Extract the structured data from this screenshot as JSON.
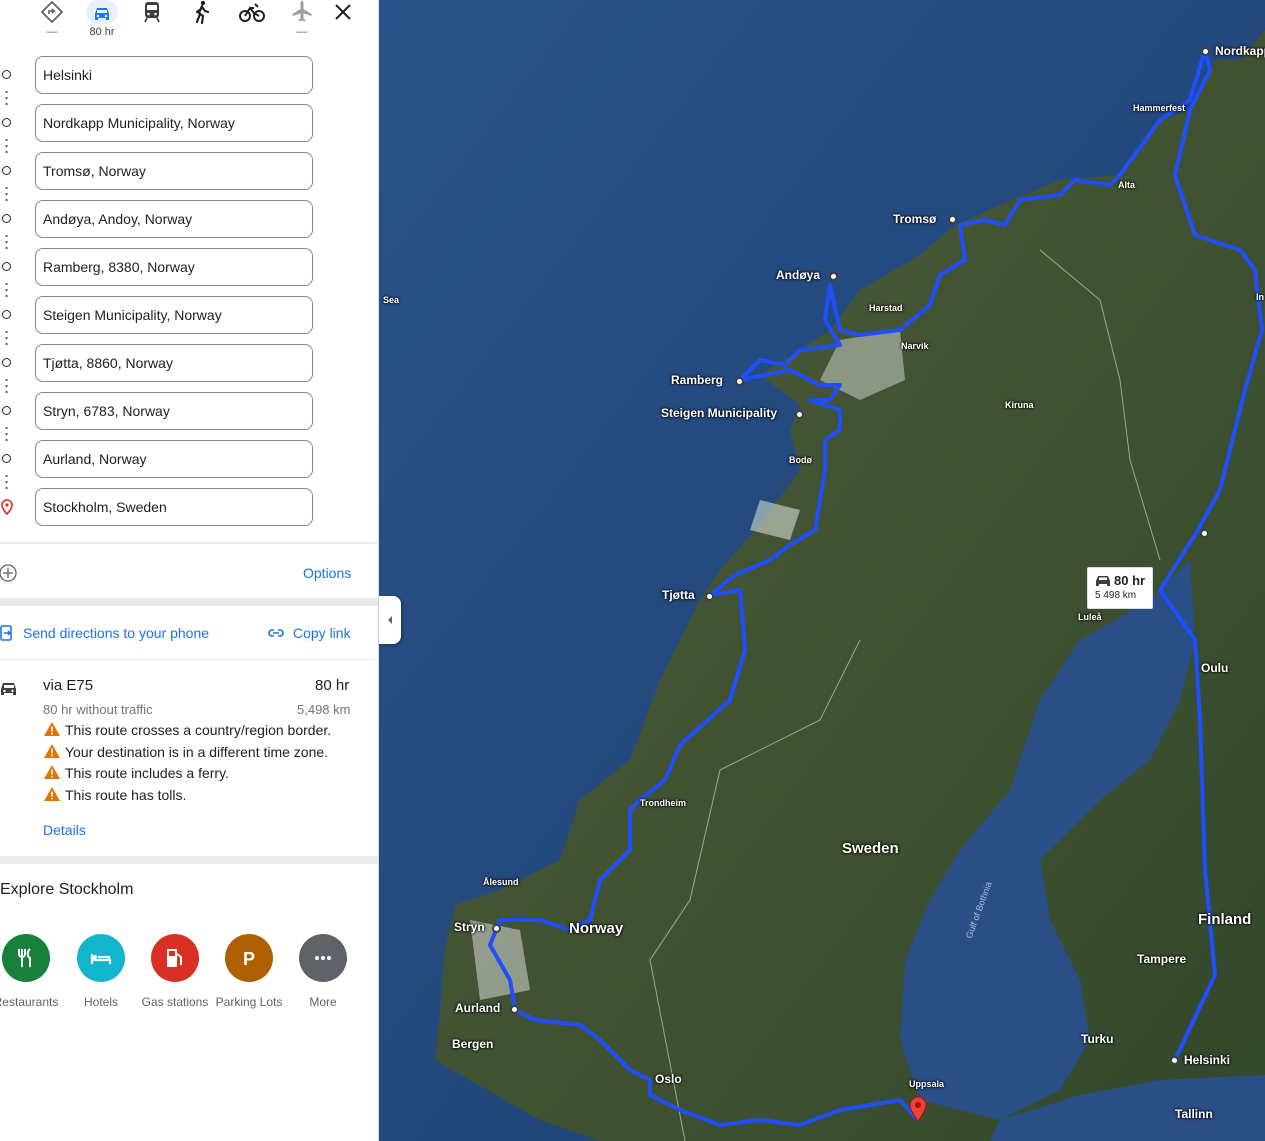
{
  "travel_modes": [
    {
      "name": "best",
      "label": "—"
    },
    {
      "name": "driving",
      "label": "80 hr"
    },
    {
      "name": "transit",
      "label": ""
    },
    {
      "name": "walking",
      "label": ""
    },
    {
      "name": "cycling",
      "label": ""
    },
    {
      "name": "flights",
      "label": "—"
    }
  ],
  "stops": [
    "Helsinki",
    "Nordkapp Municipality, Norway",
    "Tromsø, Norway",
    "Andøya, Andoy, Norway",
    "Ramberg, 8380, Norway",
    "Steigen Municipality, Norway",
    "Tjøtta, 8860, Norway",
    "Stryn, 6783, Norway",
    "Aurland, Norway",
    "Stockholm, Sweden"
  ],
  "options_label": "Options",
  "share": {
    "send": "Send directions to your phone",
    "copy": "Copy link"
  },
  "route": {
    "via": "via E75",
    "duration": "80 hr",
    "traffic": "80 hr without traffic",
    "distance": "5,498 km",
    "warnings": [
      "This route crosses a country/region border.",
      "Your destination is in a different time zone.",
      "This route includes a ferry.",
      "This route has tolls."
    ],
    "details": "Details"
  },
  "explore": {
    "title": "Explore Stockholm",
    "categories": [
      {
        "label": "Restaurants",
        "color": "#188038",
        "icon": "restaurant-icon"
      },
      {
        "label": "Hotels",
        "color": "#12b5cb",
        "icon": "hotel-icon"
      },
      {
        "label": "Gas stations",
        "color": "#d93025",
        "icon": "gas-icon"
      },
      {
        "label": "Parking Lots",
        "color": "#b06000",
        "icon": "parking-icon"
      },
      {
        "label": "More",
        "color": "#5f6368",
        "icon": "more-icon"
      }
    ]
  },
  "map": {
    "badge_time": "80 hr",
    "badge_dist": "5 498 km",
    "labels": {
      "nordkapp": "Nordkapp",
      "hammerfest": "Hammerfest",
      "alta": "Alta",
      "tromso": "Tromsø",
      "andoya": "Andøya",
      "harstad": "Harstad",
      "narvik": "Narvik",
      "ramberg": "Ramberg",
      "steigen": "Steigen Municipality",
      "kiruna": "Kiruna",
      "bodo": "Bodø",
      "tjotta": "Tjøtta",
      "lulea": "Luleå",
      "oulu": "Oulu",
      "trondheim": "Trondheim",
      "sweden": "Sweden",
      "alesund": "Ålesund",
      "stryn": "Stryn",
      "norway": "Norway",
      "aurland": "Aurland",
      "bergen": "Bergen",
      "oslo": "Oslo",
      "uppsala": "Uppsala",
      "finland": "Finland",
      "tampere": "Tampere",
      "turku": "Turku",
      "helsinki": "Helsinki",
      "tallinn": "Tallinn",
      "gulf": "Gulf of Bothnia",
      "sea": "Sea",
      "inari": "In"
    }
  },
  "colors": {
    "route": "#1f4fff",
    "accent": "#1a73e8",
    "warning": "#e37400"
  }
}
